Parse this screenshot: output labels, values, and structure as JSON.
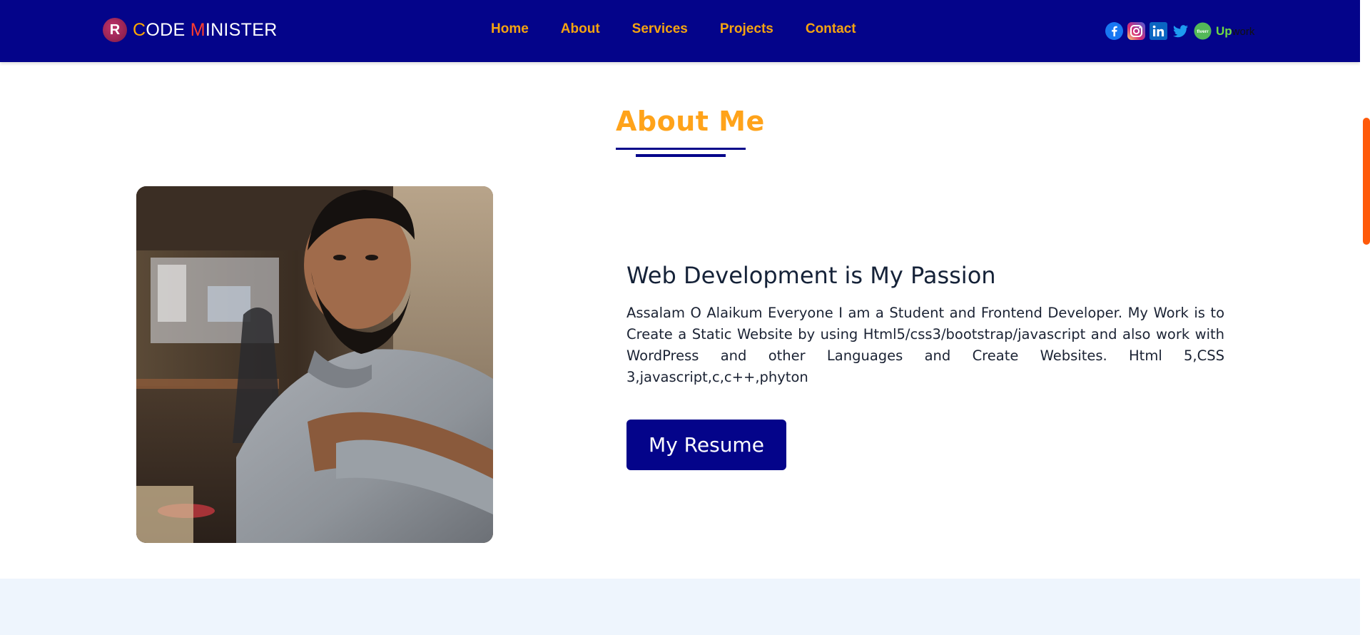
{
  "brand": {
    "logo_letter": "R",
    "first_initial": "C",
    "first_rest": "ODE ",
    "second_initial": "M",
    "second_rest": "INISTER"
  },
  "nav": {
    "items": [
      {
        "label": "Home"
      },
      {
        "label": "About"
      },
      {
        "label": "Services"
      },
      {
        "label": "Projects"
      },
      {
        "label": "Contact"
      }
    ]
  },
  "socials": {
    "upwork_up": "Up",
    "upwork_work": "work",
    "fiverr_label": "fiverr"
  },
  "about": {
    "title": "About Me",
    "heading": "Web Development is My Passion",
    "bio": "Assalam O Alaikum Everyone I am a Student and Frontend Developer. My Work is to Create a Static Website by using Html5/css3/bootstrap/javascript and also work with WordPress and other Languages and Create Websites. Html 5,CSS 3,javascript,c,c++,phyton",
    "resume_label": "My Resume"
  },
  "colors": {
    "navbar": "#04048a",
    "accent": "#ffa31a",
    "nav_link": "#f5a410",
    "scroll_thumb": "#ff5a0a"
  }
}
